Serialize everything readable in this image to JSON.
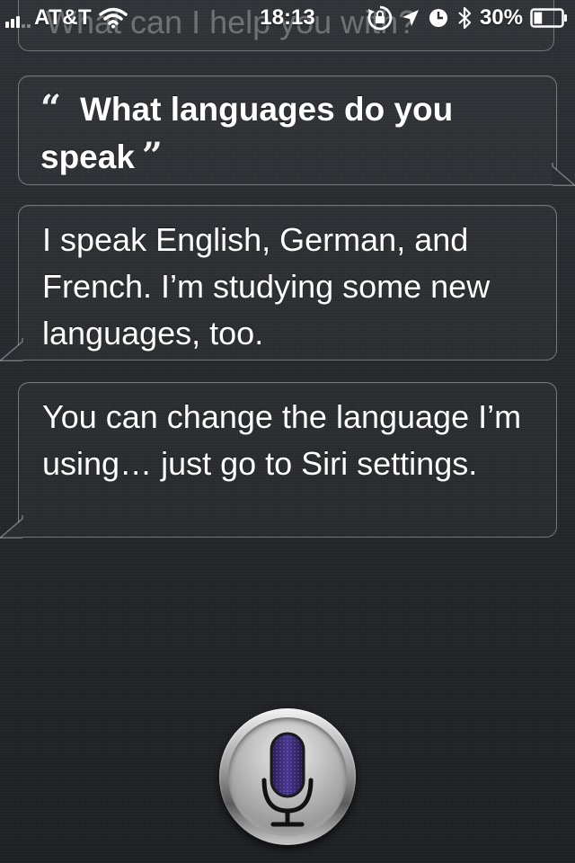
{
  "status_bar": {
    "carrier": "AT&T",
    "time": "18:13",
    "battery_percent": "30%",
    "battery_level": 0.3,
    "signal_bars": 3,
    "icons": [
      "signal-icon",
      "wifi-icon",
      "orientation-lock-icon",
      "location-icon",
      "alarm-clock-icon",
      "bluetooth-icon",
      "battery-icon"
    ]
  },
  "conversation": {
    "ghost_prompt": "What can I help you with?",
    "user_query": "What languages do you speak",
    "quote_open": "“",
    "quote_close": "”",
    "responses": [
      "I speak English, German, and French. I’m studying some new languages, too.",
      "You can change the language I’m using… just go to Siri settings."
    ]
  },
  "mic": {
    "icon": "microphone-icon",
    "accent_color": "#3b2a6e"
  }
}
